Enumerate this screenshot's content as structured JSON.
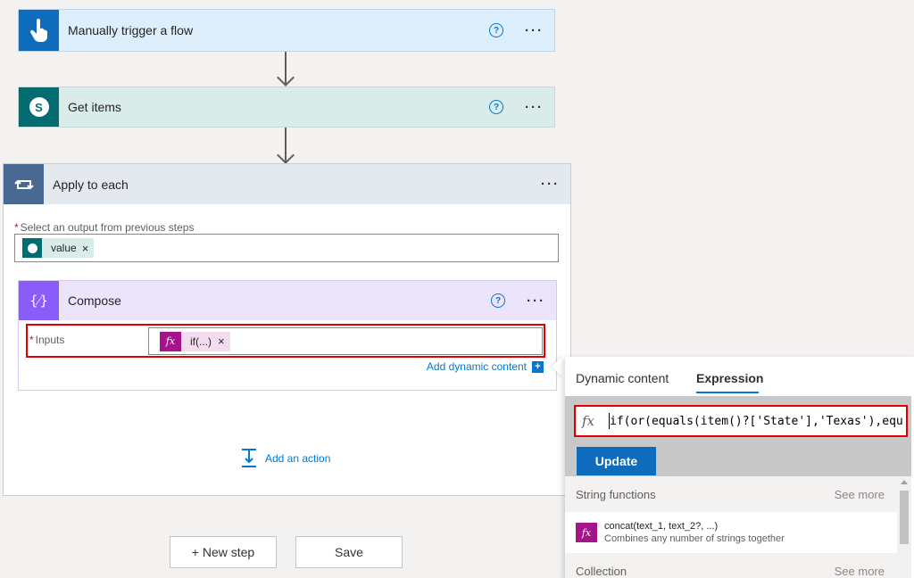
{
  "trigger": {
    "title": "Manually trigger a flow",
    "help": "?",
    "more": "···"
  },
  "get_items": {
    "title": "Get items",
    "help": "?",
    "more": "···",
    "app_letter": "S"
  },
  "apply_each": {
    "title": "Apply to each",
    "more": "···",
    "field_label": "Select an output from previous steps",
    "token_label": "value",
    "token_remove": "×"
  },
  "compose": {
    "title": "Compose",
    "help": "?",
    "more": "···",
    "inputs_label": "Inputs",
    "token_label": "if(...)",
    "token_remove": "×",
    "add_dynamic": "Add dynamic content",
    "add_dynamic_icon": "+"
  },
  "add_action": {
    "label": "Add an action"
  },
  "footer": {
    "new_step": "+ New step",
    "save": "Save"
  },
  "panel": {
    "tabs": [
      {
        "label": "Dynamic content",
        "active": false
      },
      {
        "label": "Expression",
        "active": true
      }
    ],
    "fx_label": "fx",
    "expression": "if(or(equals(item()?['State'],'Texas'),equ",
    "update_button": "Update",
    "sections": [
      {
        "title": "String functions",
        "see_more": "See more"
      },
      {
        "title": "Collection",
        "see_more": "See more"
      }
    ],
    "functions": [
      {
        "name": "concat(text_1, text_2?, ...)",
        "description": "Combines any number of strings together"
      }
    ]
  },
  "colors": {
    "trigger_tile": "#0f6cbd",
    "trigger_header": "#ddeefd",
    "sharepoint_tile": "#036c70",
    "sharepoint_header": "#d9ecea",
    "loop_tile": "#486991",
    "loop_header": "#e4e8ef",
    "compose_tile": "#8a5dfa",
    "compose_header": "#ebe4fb",
    "fx_tile": "#a5158a",
    "accent": "#0078d4",
    "highlight": "#e00000"
  }
}
